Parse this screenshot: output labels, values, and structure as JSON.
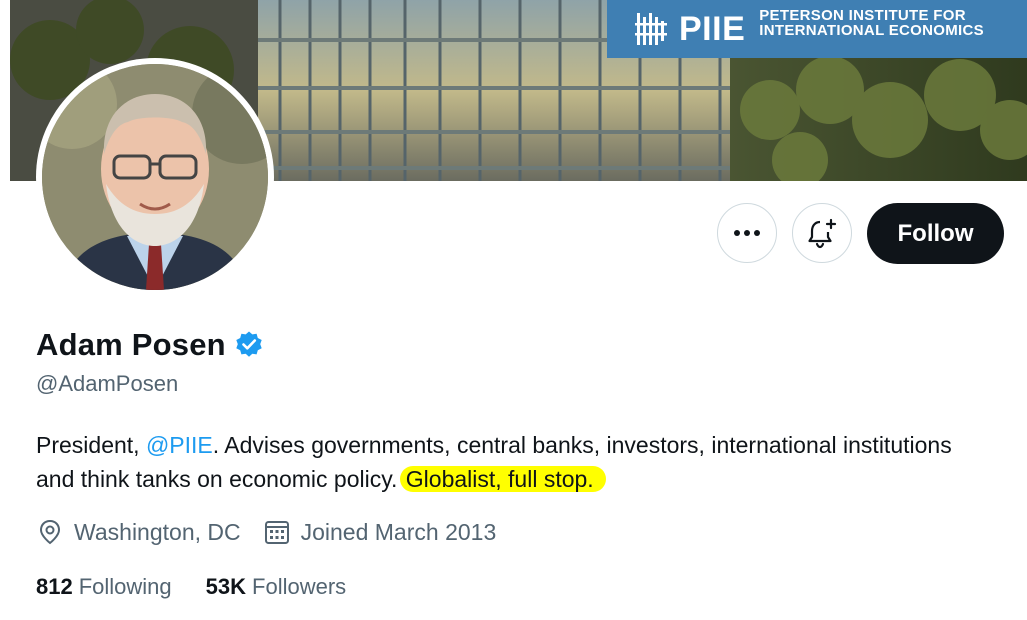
{
  "banner": {
    "logo_word": "PIIE",
    "org_line1": "PETERSON INSTITUTE FOR",
    "org_line2": "INTERNATIONAL ECONOMICS"
  },
  "actions": {
    "follow_label": "Follow"
  },
  "profile": {
    "display_name": "Adam Posen",
    "handle": "@AdamPosen",
    "verified": true,
    "bio": {
      "prefix": "President, ",
      "mention": "@PIIE",
      "body": ". Advises governments, central banks, investors, international institutions and think tanks on economic policy.",
      "highlighted": "Globalist, full stop."
    },
    "location": "Washington, DC",
    "joined": "Joined March 2013"
  },
  "stats": {
    "following_count": "812",
    "following_label": "Following",
    "followers_count": "53K",
    "followers_label": "Followers"
  },
  "colors": {
    "accent": "#1d9bf0",
    "follow_button": "#0f1419",
    "banner_logo_bg": "#3f7fb3",
    "highlight": "#ffff00"
  },
  "icons": {
    "more": "more-dots-icon",
    "notify": "bell-plus-icon",
    "verified": "verified-badge-icon",
    "location": "location-pin-icon",
    "calendar": "calendar-icon"
  }
}
